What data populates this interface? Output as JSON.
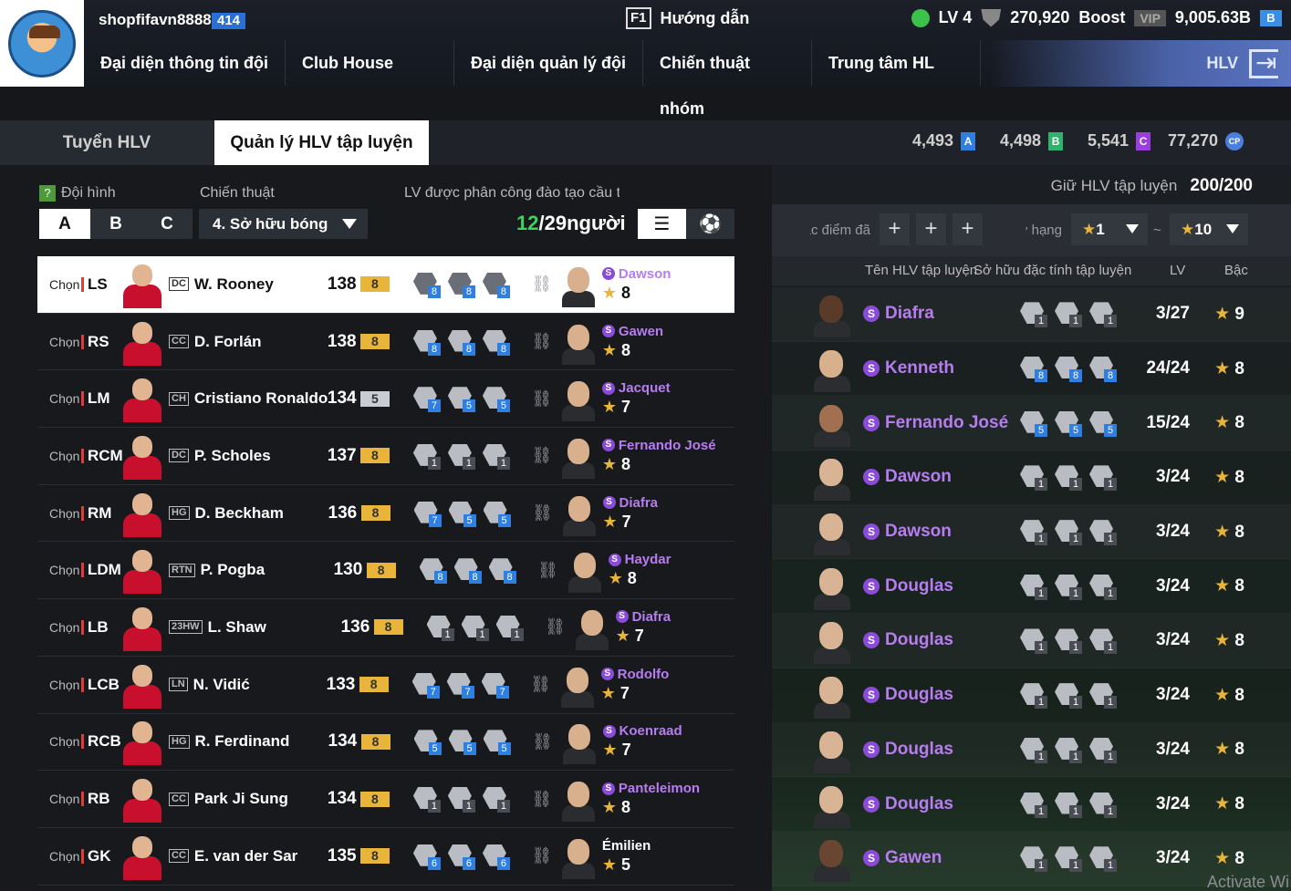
{
  "user": {
    "name": "shopfifavn8888",
    "badge": "414"
  },
  "guide": {
    "key": "F1",
    "label": "Hướng dẫn"
  },
  "stats": {
    "level": "LV 4",
    "coins": "270,920",
    "boost_label": "Boost",
    "vip": "VIP",
    "balance": "9,005.63B",
    "currency_icon": "bp-coin-icon"
  },
  "nav": [
    "Đại diện thông tin đội",
    "Club House",
    "Đại diện quản lý đội",
    "Chiến thuật nhóm",
    "Trung tâm HL"
  ],
  "hlv": {
    "label": "HLV"
  },
  "tabs": {
    "recruit": "Tuyển HLV",
    "manage": "Quản lý HLV tập luyện"
  },
  "currencies": [
    {
      "value": "4,493",
      "code": "A",
      "color": "#2f7fe0"
    },
    {
      "value": "4,498",
      "code": "B",
      "color": "#2db36b"
    },
    {
      "value": "5,541",
      "code": "C",
      "color": "#9a3ee0"
    },
    {
      "value": "77,270",
      "code": "CP",
      "color": "#4a7fe0"
    }
  ],
  "left": {
    "squad_label": "Đội hình",
    "tactic_label": "Chiến thuật",
    "assign_label": "LV được phân công đào tạo cầu thủ",
    "squads": [
      "A",
      "B",
      "C"
    ],
    "tactic_value": "4. Sở hữu bóng",
    "assigned": "12",
    "assigned_total": "/29người",
    "choose": "Chọn"
  },
  "players": [
    {
      "pos": "LS",
      "card": "DC",
      "name": "W. Rooney",
      "ovr": "138",
      "lv": "8",
      "lvc": "#e8b53a",
      "ic": [
        "8",
        "8",
        "8"
      ],
      "coach": "Dawson",
      "stars": "8",
      "hl": true
    },
    {
      "pos": "RS",
      "card": "CC",
      "name": "D. Forlán",
      "ovr": "138",
      "lv": "8",
      "lvc": "#e8b53a",
      "ic": [
        "8",
        "8",
        "8"
      ],
      "coach": "Gawen",
      "stars": "8"
    },
    {
      "pos": "LM",
      "card": "CH",
      "name": "Cristiano Ronaldo",
      "ovr": "134",
      "lv": "5",
      "lvc": "#c9ccd2",
      "ic": [
        "7",
        "5",
        "5"
      ],
      "coach": "Jacquet",
      "stars": "7"
    },
    {
      "pos": "RCM",
      "card": "DC",
      "name": "P. Scholes",
      "ovr": "137",
      "lv": "8",
      "lvc": "#e8b53a",
      "ic": [
        "1",
        "1",
        "1"
      ],
      "coach": "Fernando José",
      "stars": "8"
    },
    {
      "pos": "RM",
      "card": "HG",
      "name": "D. Beckham",
      "ovr": "136",
      "lv": "8",
      "lvc": "#e8b53a",
      "ic": [
        "7",
        "5",
        "5"
      ],
      "coach": "Diafra",
      "stars": "7"
    },
    {
      "pos": "LDM",
      "card": "RTN",
      "name": "P. Pogba",
      "ovr": "130",
      "lv": "8",
      "lvc": "#e8b53a",
      "ic": [
        "8",
        "8",
        "8"
      ],
      "coach": "Haydar",
      "stars": "8"
    },
    {
      "pos": "LB",
      "card": "23HW",
      "name": "L. Shaw",
      "ovr": "136",
      "lv": "8",
      "lvc": "#e8b53a",
      "ic": [
        "1",
        "1",
        "1"
      ],
      "coach": "Diafra",
      "stars": "7"
    },
    {
      "pos": "LCB",
      "card": "LN",
      "name": "N. Vidić",
      "ovr": "133",
      "lv": "8",
      "lvc": "#e8b53a",
      "ic": [
        "7",
        "7",
        "7"
      ],
      "coach": "Rodolfo",
      "stars": "7"
    },
    {
      "pos": "RCB",
      "card": "HG",
      "name": "R. Ferdinand",
      "ovr": "134",
      "lv": "8",
      "lvc": "#e8b53a",
      "ic": [
        "5",
        "5",
        "5"
      ],
      "coach": "Koenraad",
      "stars": "7"
    },
    {
      "pos": "RB",
      "card": "CC",
      "name": "Park Ji Sung",
      "ovr": "134",
      "lv": "8",
      "lvc": "#e8b53a",
      "ic": [
        "1",
        "1",
        "1"
      ],
      "coach": "Panteleimon",
      "stars": "8"
    },
    {
      "pos": "GK",
      "card": "CC",
      "name": "E. van der Sar",
      "ovr": "135",
      "lv": "8",
      "lvc": "#e8b53a",
      "ic": [
        "6",
        "6",
        "6"
      ],
      "coach": "Émilien",
      "stars": "5",
      "plain": true
    }
  ],
  "right": {
    "hold_label": "Giữ HLV tập luyện",
    "hold_value": "200/200",
    "filter_attr": "Đặc điểm đã",
    "filter_rank": "Thứ hạng",
    "rank_min": "1",
    "rank_sep": "~",
    "rank_max": "10",
    "col_name": "Tên HLV tập luyện",
    "col_attr": "Sở hữu đặc tính tập luyện",
    "col_lv": "LV",
    "col_rank": "Bậc"
  },
  "coaches": [
    {
      "name": "Diafra",
      "ic": [
        "1",
        "1",
        "1"
      ],
      "lv": "3/27",
      "rank": "9",
      "skin": "#5a3a28"
    },
    {
      "name": "Kenneth",
      "ic": [
        "8",
        "8",
        "8"
      ],
      "lv": "24/24",
      "rank": "8",
      "skin": "#d8b08c"
    },
    {
      "name": "Fernando José",
      "ic": [
        "5",
        "5",
        "5"
      ],
      "lv": "15/24",
      "rank": "8",
      "skin": "#a07050"
    },
    {
      "name": "Dawson",
      "ic": [
        "1",
        "1",
        "1"
      ],
      "lv": "3/24",
      "rank": "8",
      "skin": "#d9b494"
    },
    {
      "name": "Dawson",
      "ic": [
        "1",
        "1",
        "1"
      ],
      "lv": "3/24",
      "rank": "8",
      "skin": "#d9b494"
    },
    {
      "name": "Douglas",
      "ic": [
        "1",
        "1",
        "1"
      ],
      "lv": "3/24",
      "rank": "8",
      "skin": "#d9b494"
    },
    {
      "name": "Douglas",
      "ic": [
        "1",
        "1",
        "1"
      ],
      "lv": "3/24",
      "rank": "8",
      "skin": "#d9b494"
    },
    {
      "name": "Douglas",
      "ic": [
        "1",
        "1",
        "1"
      ],
      "lv": "3/24",
      "rank": "8",
      "skin": "#d9b494"
    },
    {
      "name": "Douglas",
      "ic": [
        "1",
        "1",
        "1"
      ],
      "lv": "3/24",
      "rank": "8",
      "skin": "#d9b494"
    },
    {
      "name": "Douglas",
      "ic": [
        "1",
        "1",
        "1"
      ],
      "lv": "3/24",
      "rank": "8",
      "skin": "#d9b494"
    },
    {
      "name": "Gawen",
      "ic": [
        "1",
        "1",
        "1"
      ],
      "lv": "3/24",
      "rank": "8",
      "skin": "#6a4632"
    }
  ],
  "watermark": "Activate Wi"
}
